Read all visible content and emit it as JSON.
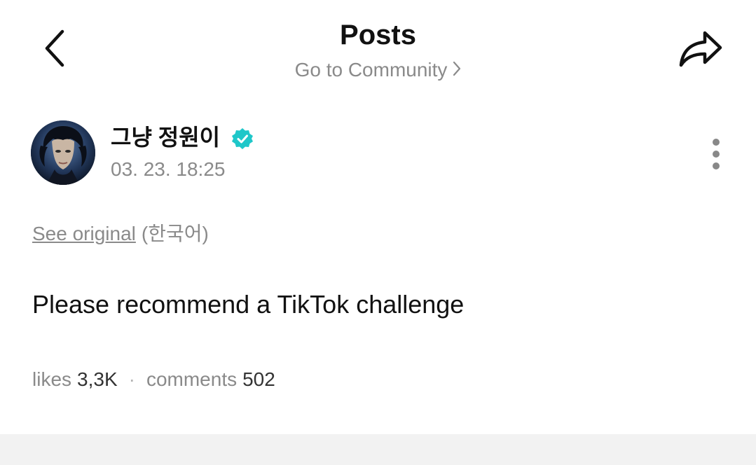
{
  "header": {
    "title": "Posts",
    "community_link": "Go to Community"
  },
  "author": {
    "name": "그냥 정원이",
    "timestamp": "03. 23. 18:25",
    "verified_color": "#1fc7c9"
  },
  "translation": {
    "see_original": "See original",
    "language": "(한국어)"
  },
  "post": {
    "text": "Please recommend a TikTok challenge"
  },
  "stats": {
    "likes_label": "likes",
    "likes_count": "3,3K",
    "separator": "·",
    "comments_label": "comments",
    "comments_count": "502"
  },
  "icons": {
    "back": "chevron-left-icon",
    "share": "share-arrow-icon",
    "more": "more-vertical-icon",
    "verified": "verified-badge-icon",
    "community_chevron": "chevron-right-icon"
  }
}
